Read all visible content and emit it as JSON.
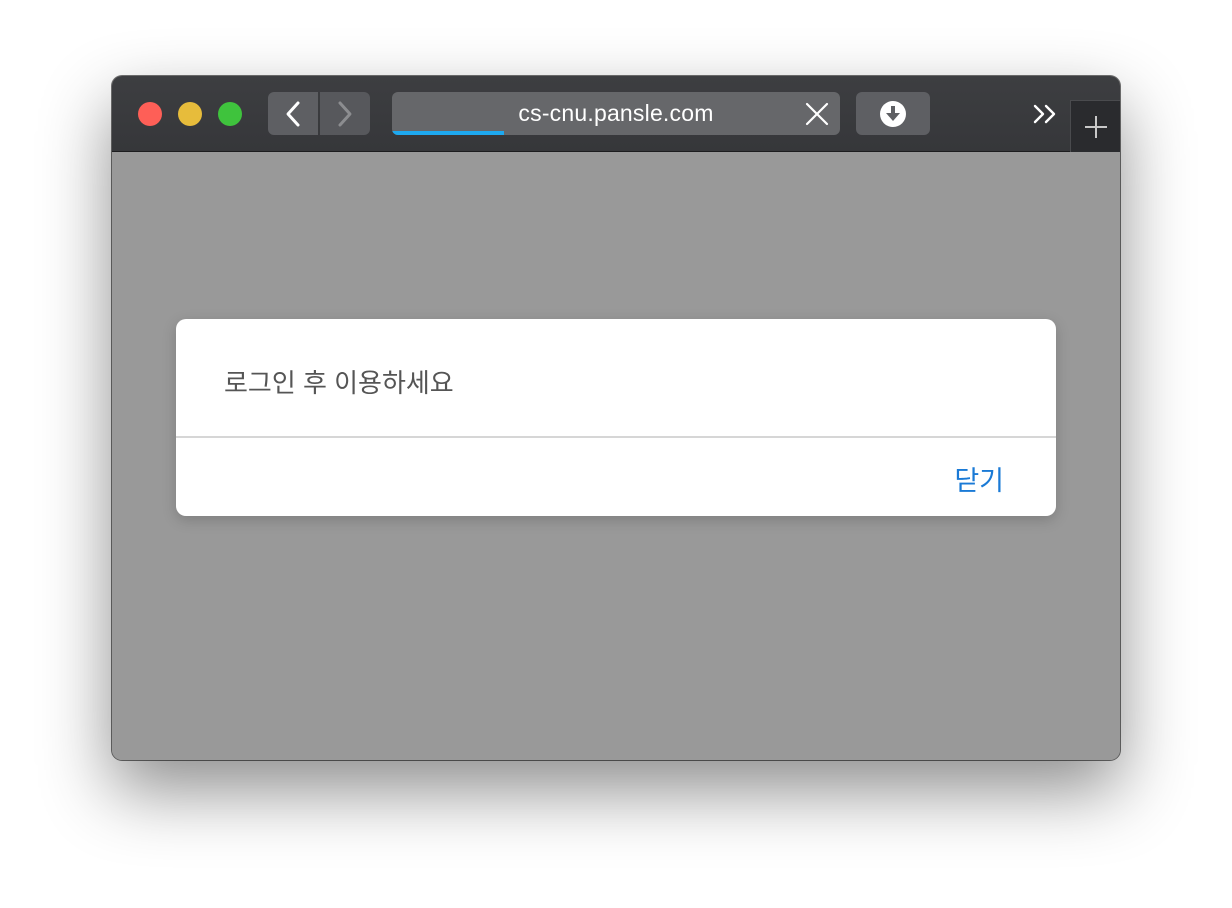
{
  "window": {
    "traffic_lights": {
      "close_color": "#fe5f57",
      "minimize_color": "#e7bc3b",
      "zoom_color": "#3fc33d"
    }
  },
  "toolbar": {
    "back_icon": "chevron-left-icon",
    "forward_icon": "chevron-right-icon",
    "address": "cs-cnu.pansle.com",
    "clear_icon": "close-icon",
    "load_progress": 0.25,
    "progress_color": "#1ea9f0",
    "download_icon": "download-icon",
    "overflow_icon": "double-chevron-right-icon",
    "new_tab_icon": "plus-icon"
  },
  "dialog": {
    "message": "로그인 후 이용하세요",
    "close_label": "닫기",
    "close_color": "#1a7ad6"
  }
}
